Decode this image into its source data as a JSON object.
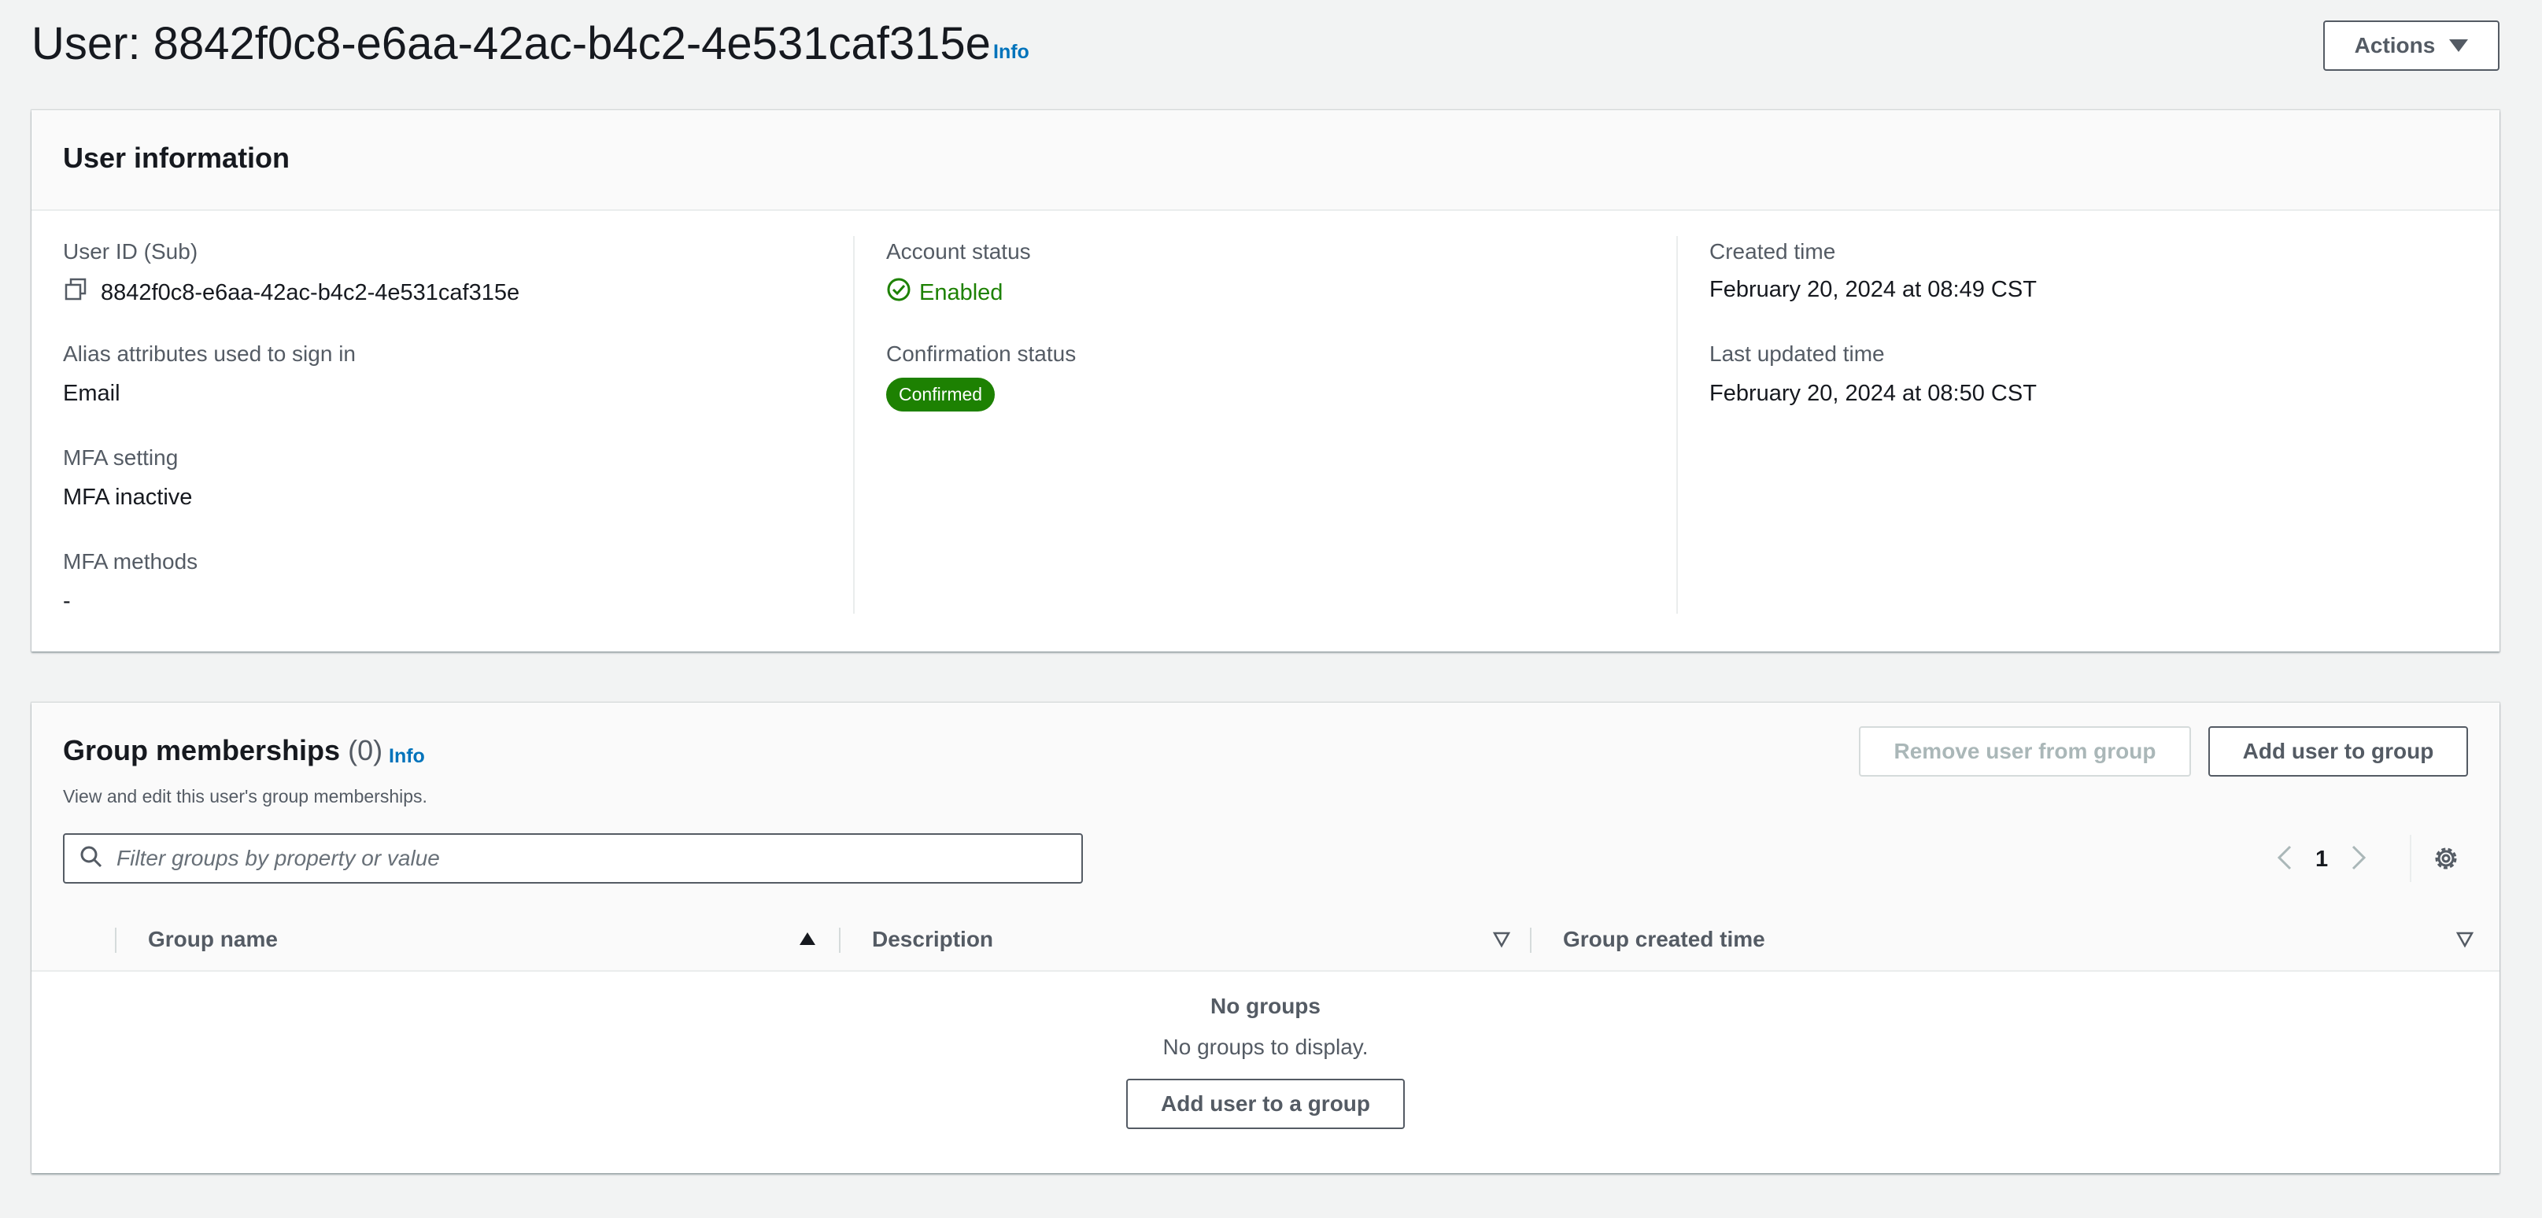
{
  "header": {
    "title": "User: 8842f0c8-e6aa-42ac-b4c2-4e531caf315e",
    "info_label": "Info",
    "actions_label": "Actions"
  },
  "user_info": {
    "title": "User information",
    "user_id_label": "User ID (Sub)",
    "user_id_value": "8842f0c8-e6aa-42ac-b4c2-4e531caf315e",
    "alias_label": "Alias attributes used to sign in",
    "alias_value": "Email",
    "mfa_setting_label": "MFA setting",
    "mfa_setting_value": "MFA inactive",
    "mfa_methods_label": "MFA methods",
    "mfa_methods_value": "-",
    "account_status_label": "Account status",
    "account_status_value": "Enabled",
    "confirmation_status_label": "Confirmation status",
    "confirmation_status_value": "Confirmed",
    "created_label": "Created time",
    "created_value": "February 20, 2024 at 08:49 CST",
    "updated_label": "Last updated time",
    "updated_value": "February 20, 2024 at 08:50 CST"
  },
  "groups": {
    "title": "Group memberships",
    "count": "(0)",
    "info_label": "Info",
    "description": "View and edit this user's group memberships.",
    "remove_label": "Remove user from group",
    "add_label": "Add user to group",
    "filter_placeholder": "Filter groups by property or value",
    "filter_value": "",
    "page": "1",
    "columns": [
      "Group name",
      "Description",
      "Group created time"
    ],
    "empty_title": "No groups",
    "empty_sub": "No groups to display.",
    "empty_button": "Add user to a group"
  },
  "colors": {
    "accent_link": "#0073bb",
    "success": "#1d8102",
    "text_secondary": "#545b64"
  }
}
